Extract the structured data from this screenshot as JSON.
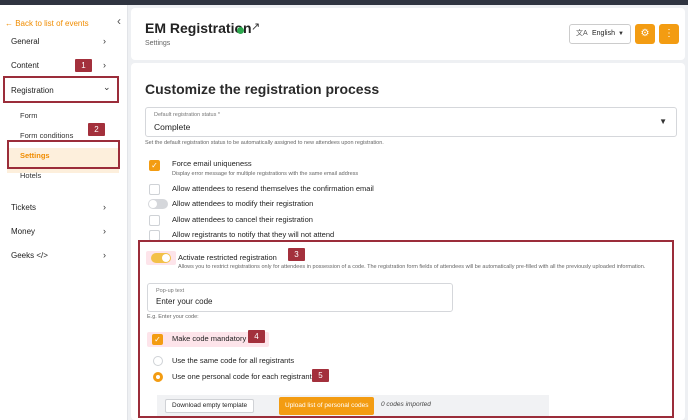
{
  "sidebar": {
    "back_link": "← Back to list of events",
    "items": [
      {
        "label": "General"
      },
      {
        "label": "Content"
      },
      {
        "label": "Registration"
      },
      {
        "label": "Tickets"
      },
      {
        "label": "Money"
      },
      {
        "label": "Geeks </>"
      }
    ],
    "sub_items": [
      {
        "label": "Form"
      },
      {
        "label": "Form conditions"
      },
      {
        "label": "Settings"
      },
      {
        "label": "Hotels"
      }
    ],
    "collapse_glyph": "‹",
    "chevron_right": "›",
    "chevron_down": "⌄"
  },
  "header": {
    "title": "EM Registration",
    "subtitle": "Settings",
    "language": "English",
    "lang_icon": "文A",
    "status_color": "#2ea84f"
  },
  "main": {
    "heading": "Customize the registration process",
    "status_select": {
      "label": "Default registration status *",
      "value": "Complete",
      "help": "Set the default registration status to be automatically assigned to new attendees upon registration."
    },
    "options": [
      {
        "label": "Force email uniqueness",
        "sub": "Display error message for multiple registrations with the same email address",
        "checked": true
      },
      {
        "label": "Allow attendees to resend themselves the confirmation email",
        "checked": false
      },
      {
        "label": "Allow attendees to modify their registration",
        "toggle": "off"
      },
      {
        "label": "Allow attendees to cancel their registration",
        "checked": false
      },
      {
        "label": "Allow registrants to notify that they will not attend",
        "checked": false
      }
    ],
    "restricted": {
      "label": "Activate restricted registration",
      "description": "Allows you to restrict registrations only for attendees in possession of a code. The registration form fields of attendees will be automatically pre-filled with all the previously uploaded information.",
      "popup_label": "Pop-up text",
      "popup_value": "Enter your code",
      "example": "E.g. Enter your code:",
      "mandatory_label": "Make code mandatory",
      "radio_same": "Use the same code for all registrants",
      "radio_personal": "Use one personal code for each registrant",
      "download_btn": "Download empty template",
      "upload_btn": "Upload list of personal codes",
      "codes_imported": "0 codes imported"
    }
  },
  "annotations": [
    "1",
    "2",
    "3",
    "4",
    "5"
  ],
  "colors": {
    "accent": "#f39c12",
    "annotation": "#a3303c"
  }
}
